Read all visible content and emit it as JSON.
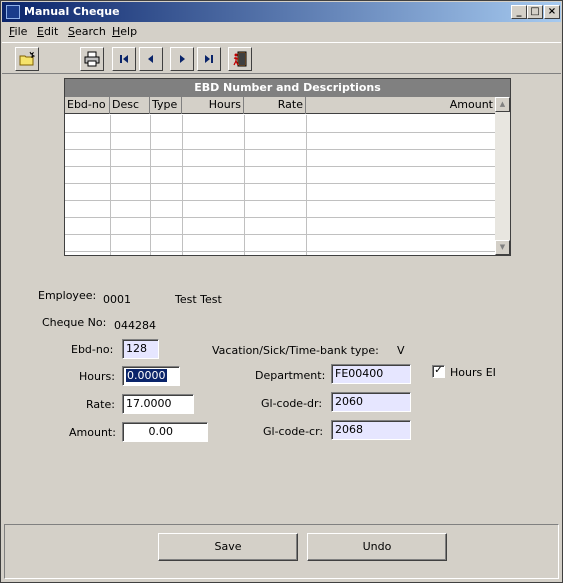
{
  "window": {
    "title": "Manual Cheque",
    "controls": {
      "minimize": "_",
      "maximize": "□",
      "close": "×"
    }
  },
  "menu": [
    {
      "label": "File",
      "accel": "F",
      "rest": "ile"
    },
    {
      "label": "Edit",
      "accel": "E",
      "rest": "dit"
    },
    {
      "label": "Search",
      "accel": "S",
      "rest": "earch"
    },
    {
      "label": "Help",
      "accel": "H",
      "rest": "elp"
    }
  ],
  "toolbar": {
    "icons": [
      "open-folder-icon",
      "print-icon",
      "first-record-icon",
      "previous-record-icon",
      "next-record-icon",
      "last-record-icon",
      "exit-door-icon"
    ],
    "accent": "#0a246a"
  },
  "grid": {
    "caption": "EBD Number and Descriptions",
    "columns": [
      "Ebd-no",
      "Desc",
      "Type",
      "Hours",
      "Rate",
      "Amount"
    ],
    "rows": []
  },
  "employee": {
    "label": "Employee:",
    "number": "0001",
    "name": "Test Test"
  },
  "cheque": {
    "label": "Cheque No:",
    "value": "044284"
  },
  "form": {
    "ebd_no": {
      "label": "Ebd-no:",
      "value": "128"
    },
    "hours": {
      "label": "Hours:",
      "value": "0.0000"
    },
    "rate": {
      "label": "Rate:",
      "value": "17.0000"
    },
    "amount": {
      "label": "Amount:",
      "value": "0.00"
    },
    "vacation": {
      "label": "Vacation/Sick/Time-bank type:",
      "value": "V"
    },
    "department": {
      "label": "Department:",
      "value": "FE00400"
    },
    "gl_dr": {
      "label": "Gl-code-dr:",
      "value": "2060"
    },
    "gl_cr": {
      "label": "Gl-code-cr:",
      "value": "2068"
    },
    "hours_ei": {
      "label": "Hours EI",
      "checked": true,
      "mark": "✓"
    }
  },
  "buttons": {
    "save": "Save",
    "undo": "Undo"
  }
}
